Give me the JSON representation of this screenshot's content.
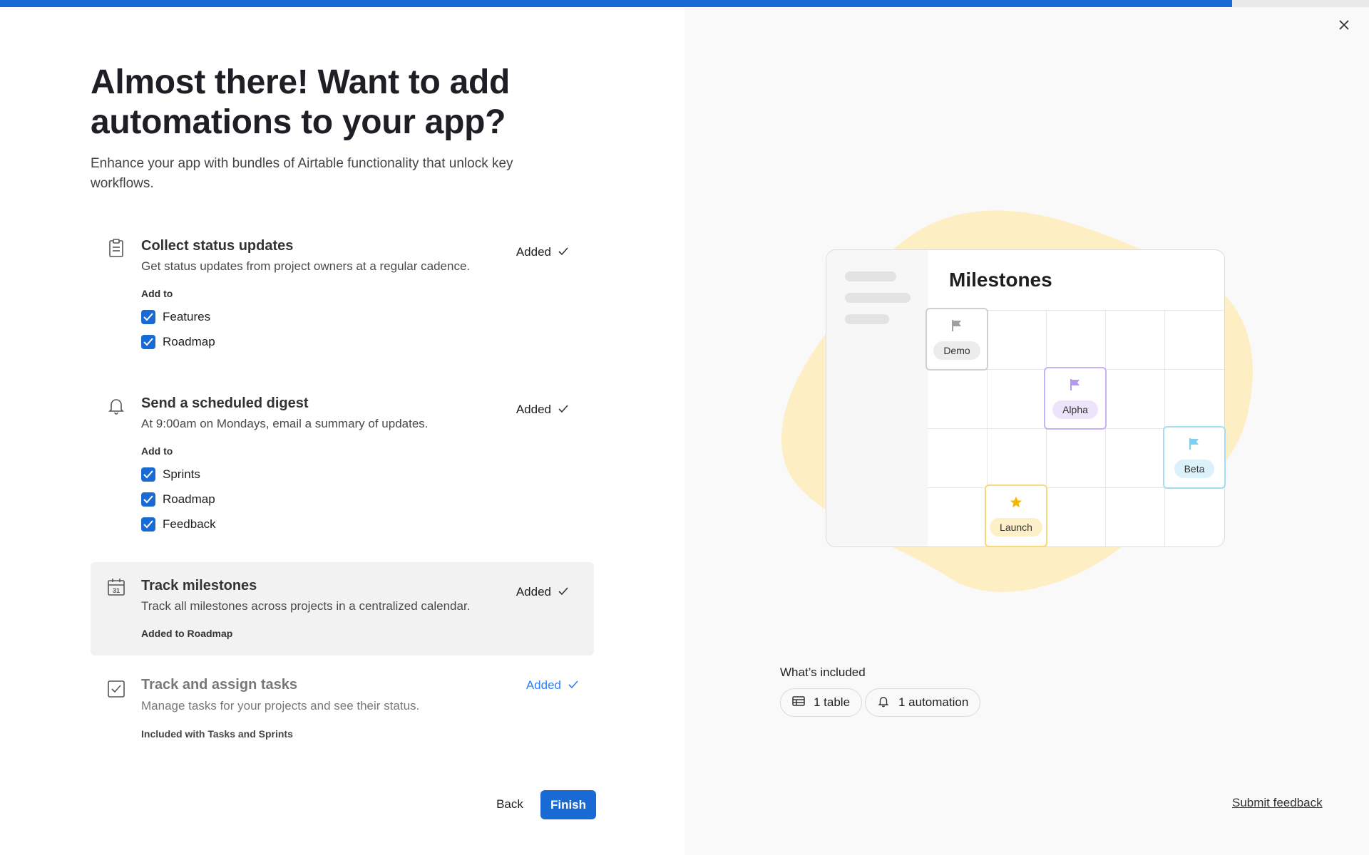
{
  "progress": {
    "fraction": 0.9
  },
  "header": {
    "title": "Almost there! Want to add automations to your app?",
    "subtitle": "Enhance your app with bundles of Airtable functionality that unlock key workflows."
  },
  "bundles": [
    {
      "icon": "clipboard-icon",
      "title": "Collect status updates",
      "description": "Get status updates from project owners at a regular cadence.",
      "status": "Added",
      "add_to_label": "Add to",
      "targets": [
        "Features",
        "Roadmap"
      ]
    },
    {
      "icon": "bell-icon",
      "title": "Send a scheduled digest",
      "description": "At 9:00am on Mondays, email a summary of updates.",
      "status": "Added",
      "add_to_label": "Add to",
      "targets": [
        "Sprints",
        "Roadmap",
        "Feedback"
      ]
    },
    {
      "icon": "calendar-icon",
      "icon_text": "31",
      "title": "Track milestones",
      "description": "Track all milestones across projects in a centralized calendar.",
      "status": "Added",
      "note": "Added to Roadmap"
    },
    {
      "icon": "checkbox-icon",
      "title": "Track and assign tasks",
      "description": "Manage tasks for your projects and see their status.",
      "status": "Added",
      "note": "Included with Tasks and Sprints"
    }
  ],
  "footer": {
    "back_label": "Back",
    "finish_label": "Finish",
    "feedback_label": "Submit feedback"
  },
  "preview": {
    "card_title": "Milestones",
    "milestones": [
      {
        "label": "Demo",
        "icon": "flag-icon",
        "color": "#a0a0a0"
      },
      {
        "label": "Alpha",
        "icon": "flag-icon",
        "color": "#b69af0"
      },
      {
        "label": "Beta",
        "icon": "flag-icon",
        "color": "#7fd0f0"
      },
      {
        "label": "Launch",
        "icon": "star-icon",
        "color": "#f5c542"
      }
    ]
  },
  "included": {
    "label": "What’s included",
    "chips": [
      {
        "icon": "table-icon",
        "label": "1 table"
      },
      {
        "icon": "bell-icon",
        "label": "1 automation"
      }
    ]
  },
  "colors": {
    "accent": "#1a6ad6",
    "added_link": "#2d7ff9",
    "blob": "#fdeec4"
  }
}
